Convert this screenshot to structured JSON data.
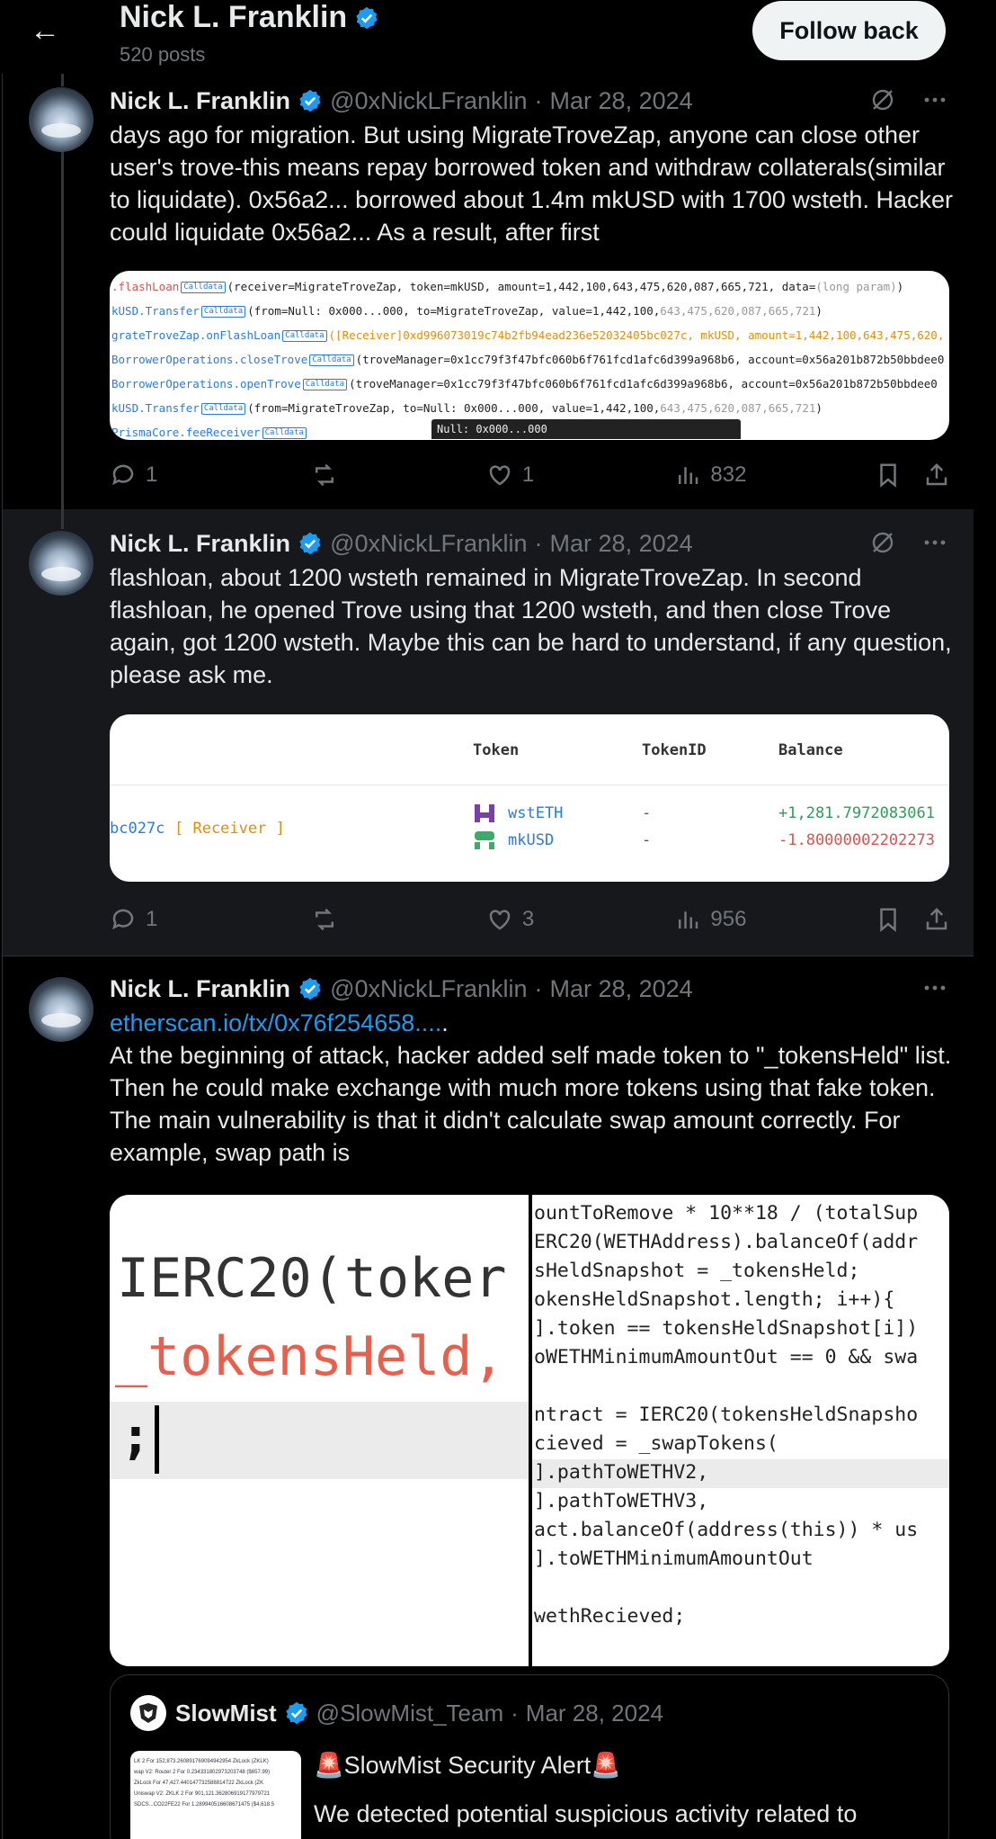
{
  "header": {
    "back_label": "←",
    "name": "Nick L. Franklin",
    "posts": "520 posts",
    "follow_label": "Follow back"
  },
  "colors": {
    "accent": "#1d9bf0",
    "bg": "#000000",
    "muted": "#71767b"
  },
  "tweets": [
    {
      "name": "Nick L. Franklin",
      "handle": "@0xNickLFranklin",
      "sep": "·",
      "date": "Mar 28, 2024",
      "text": "days ago for migration. But using MigrateTroveZap, anyone can close other user's trove-this means repay borrowed token and withdraw collaterals(similar to liquidate). 0x56a2... borrowed about 1.4m mkUSD with 1700 wsteth. Hacker could liquidate 0x56a2... As a result, after first",
      "replies": "1",
      "likes": "1",
      "views": "832"
    },
    {
      "name": "Nick L. Franklin",
      "handle": "@0xNickLFranklin",
      "sep": "·",
      "date": "Mar 28, 2024",
      "text": "flashloan, about 1200 wsteth remained in MigrateTroveZap. In second flashloan, he opened Trove using that 1200 wsteth, and then close Trove again, got 1200 wsteth. Maybe this can be hard to understand, if any question, please ask me.",
      "replies": "1",
      "likes": "3",
      "views": "956"
    },
    {
      "name": "Nick L. Franklin",
      "handle": "@0xNickLFranklin",
      "sep": "·",
      "date": "Mar 28, 2024",
      "link": "etherscan.io/tx/0x76f254658....",
      "link_suffix": ".",
      "text": "At the beginning of attack, hacker added self made token to \"_tokensHeld\" list. Then he could make exchange with much more tokens using that fake token. The main vulnerability is that it didn't calculate swap amount correctly. For example, swap path is"
    }
  ],
  "trace": {
    "tag": "Calldata",
    "rows": [
      {
        "pre": ".flashLoan",
        "args": "(receiver=MigrateTroveZap, token=mkUSD, amount=1,442,100,643,475,620,087,665,721, data=",
        "gray": "(long param)",
        "end": ")"
      },
      {
        "pre": "kUSD.Transfer",
        "args": "(from=Null: 0x000...000, to=MigrateTroveZap, value=1,442,100,",
        "gray": "643,475,620,087,665,721",
        "end": ")"
      },
      {
        "pre": "grateTroveZap.onFlashLoan",
        "args": "([Receiver]0xd996073019c74b2fb94ead236e52032405bc027c, mkUSD, amount=1,442,100,643,475,620,",
        "gray": "",
        "end": ""
      },
      {
        "pre": " BorrowerOperations.closeTrove",
        "args": "(troveManager=0x1cc79f3f47bfc060b6f761fcd1afc6d399a968b6, account=0x56a201b872b50bbdee0",
        "gray": "",
        "end": ""
      },
      {
        "pre": " BorrowerOperations.openTrove",
        "args": "(troveManager=0x1cc79f3f47bfc060b6f761fcd1afc6d399a968b6, account=0x56a201b872b50bbdee0",
        "gray": "",
        "end": ""
      },
      {
        "pre": "kUSD.Transfer",
        "args": "(from=MigrateTroveZap, to=Null: 0x000...000, value=1,442,100,",
        "gray": "643,475,620,087,665,721",
        "end": ")"
      },
      {
        "pre": "   PrismaCore.feeReceiver",
        "args": "",
        "gray": "",
        "end": ""
      }
    ],
    "tooltip": "Null: 0x000...000"
  },
  "token_table": {
    "headers": [
      "Token",
      "TokenID",
      "Balance"
    ],
    "address": "bc027c",
    "receiver": "[ Receiver ]",
    "rows": [
      {
        "token": "wstETH",
        "id": "-",
        "balance": "+1,281.7972083061",
        "color": "#2e9e5b"
      },
      {
        "token": "mkUSD",
        "id": "-",
        "balance": "-1.80000002202273",
        "color": "#d9534f"
      }
    ]
  },
  "code": {
    "left_lines": [
      "IERC20(toker",
      "_tokensHeld,",
      ";"
    ],
    "right_lines": [
      "ountToRemove * 10**18 / (totalSup",
      "ERC20(WETHAddress).balanceOf(addr",
      "sHeldSnapshot =  _tokensHeld;",
      "okensHeldSnapshot.length; i++){",
      "].token == tokensHeldSnapshot[i])",
      "oWETHMinimumAmountOut == 0 && swa",
      "",
      "ntract = IERC20(tokensHeldSnapsho",
      "cieved = _swapTokens(",
      "].pathToWETHV2,",
      "].pathToWETHV3,",
      "act.balanceOf(address(this)) * us",
      "].toWETHMinimumAmountOut",
      "",
      "wethRecieved;"
    ]
  },
  "quote": {
    "name": "SlowMist",
    "handle": "@SlowMist_Team",
    "sep": "·",
    "date": "Mar 28, 2024",
    "title": "🚨SlowMist Security Alert🚨",
    "text": "We detected potential suspicious activity related to",
    "thumb_lines": [
      "LK 2 For 152,873.260891769094942954 ZkLock (ZKLK)",
      "wap V2: Router 2 For 0.234331802973203748 ($657.99)",
      "ZkLock For 47,427.440147732588814722 ZkLock (ZK",
      "Uniswap V2: ZKLK 2 For 901,121.362806919177979721",
      "SDCS...CO22FE22 For 1.289940516608671475 ($4,618.5"
    ]
  }
}
